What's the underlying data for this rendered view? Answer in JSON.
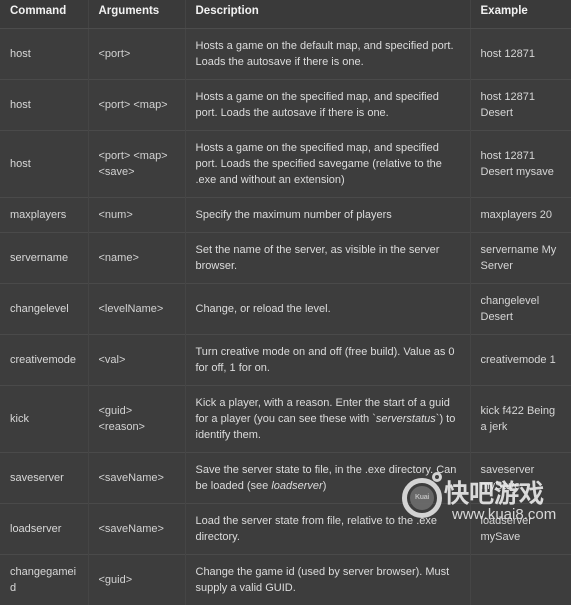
{
  "table": {
    "headers": [
      "Command",
      "Arguments",
      "Description",
      "Example"
    ],
    "rows": [
      {
        "command": "host",
        "arguments": "<port>",
        "description": "Hosts a game on the default map, and specified port. Loads the autosave if there is one.",
        "example": "host 12871"
      },
      {
        "command": "host",
        "arguments": "<port> <map>",
        "description": "Hosts a game on the specified map, and specified port. Loads the autosave if there is one.",
        "example": "host 12871 Desert"
      },
      {
        "command": "host",
        "arguments": "<port> <map> <save>",
        "description": "Hosts a game on the specified map, and specified port. Loads the specified savegame (relative to the .exe and without an extension)",
        "example": "host 12871 Desert mysave"
      },
      {
        "command": "maxplayers",
        "arguments": "<num>",
        "description": "Specify the maximum number of players",
        "example": "maxplayers 20"
      },
      {
        "command": "servername",
        "arguments": "<name>",
        "description": "Set the name of the server, as visible in the server browser.",
        "example": "servername My Server"
      },
      {
        "command": "changelevel",
        "arguments": "<levelName>",
        "description": "Change, or reload the level.",
        "example": "changelevel Desert"
      },
      {
        "command": "creativemode",
        "arguments": "<val>",
        "description": "Turn creative mode on and off (free build). Value as 0 for off, 1 for on.",
        "example": "creativemode 1"
      },
      {
        "command": "kick",
        "arguments": "<guid> <reason>",
        "description_pre": "Kick a player, with a reason. Enter the start of a guid for a player (you can see these with `",
        "description_italic": "serverstatus",
        "description_post": "`) to identify them.",
        "example": "kick f422 Being a jerk"
      },
      {
        "command": "saveserver",
        "arguments": "<saveName>",
        "description_pre": "Save the server state to file, in the .exe directory. Can be loaded (see ",
        "description_italic": "loadserver",
        "description_post": ")",
        "example": "saveserver mySave"
      },
      {
        "command": "loadserver",
        "arguments": "<saveName>",
        "description": "Load the server state from file, relative to the .exe directory.",
        "example": "loadserver mySave"
      },
      {
        "command": "changegameid",
        "arguments": "<guid>",
        "description": "Change the game id (used by server browser). Must supply a valid GUID.",
        "example": ""
      }
    ]
  },
  "watermark": {
    "brand_cn": "快吧游戏",
    "url": "www.kuai8.com",
    "logo_text": "Kuai"
  },
  "colors": {
    "page_background": "#3b3b3b",
    "header_background": "#3a3a3a",
    "row_background": "#3d3d3d",
    "border": "#4a4a4a",
    "text": "#d9d9d9",
    "header_text": "#f2f2f2"
  }
}
